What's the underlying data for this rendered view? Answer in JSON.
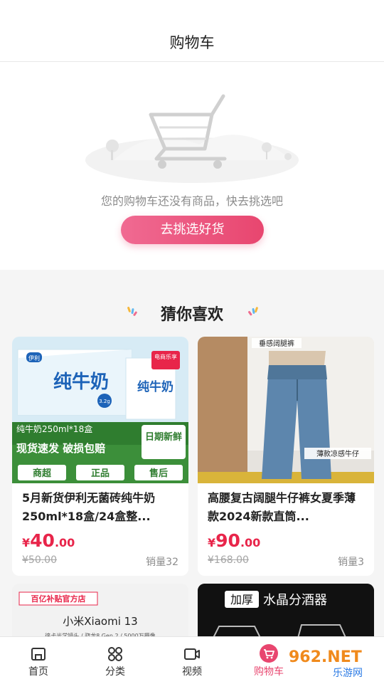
{
  "header": {
    "title": "购物车"
  },
  "empty_state": {
    "message": "您的购物车还没有商品，快去挑选吧",
    "button_label": "去挑选好货"
  },
  "recommend": {
    "title": "猜你喜欢"
  },
  "products": [
    {
      "name": "5月新货伊利无菌砖纯牛奶250ml*18盒/24盒整...",
      "currency": "¥",
      "price_int": "40",
      "price_dec": ".00",
      "original_price": "¥50.00",
      "sales": "销量32",
      "image_texts": {
        "box_title": "纯牛奶",
        "banner": "纯牛奶250ml*18盒",
        "slogan": "现货速发 破损包赔",
        "tag": "日期新鲜",
        "tags": [
          "商超",
          "正品",
          "售后"
        ],
        "badge": "电商乐享",
        "brand": "伊利",
        "protein": "3.2g"
      }
    },
    {
      "name": "高腰复古阔腿牛仔裤女夏季薄款2024新款直筒...",
      "currency": "¥",
      "price_int": "90",
      "price_dec": ".00",
      "original_price": "¥168.00",
      "sales": "销量3",
      "image_texts": {
        "top_tag": "垂感阔腿裤",
        "bottom_tag": "薄款凉感牛仔"
      }
    },
    {
      "image_texts": {
        "store": "百亿补贴官方店",
        "model": "小米Xiaomi 13",
        "sub": "徕卡光学镜头 / 骁龙8 Gen 2 / 5000万摄像"
      }
    },
    {
      "image_texts": {
        "badge": "加厚",
        "title": "水晶分酒器"
      }
    }
  ],
  "tabbar": {
    "items": [
      {
        "label": "首页",
        "icon": "home-icon",
        "active": false
      },
      {
        "label": "分类",
        "icon": "category-icon",
        "active": false
      },
      {
        "label": "视频",
        "icon": "video-icon",
        "active": false
      },
      {
        "label": "购物车",
        "icon": "cart-icon",
        "active": true
      }
    ]
  },
  "watermark": {
    "line1": "962.NET",
    "line2": "乐游网"
  },
  "colors": {
    "accent": "#e8466f",
    "price": "#e8254a"
  }
}
